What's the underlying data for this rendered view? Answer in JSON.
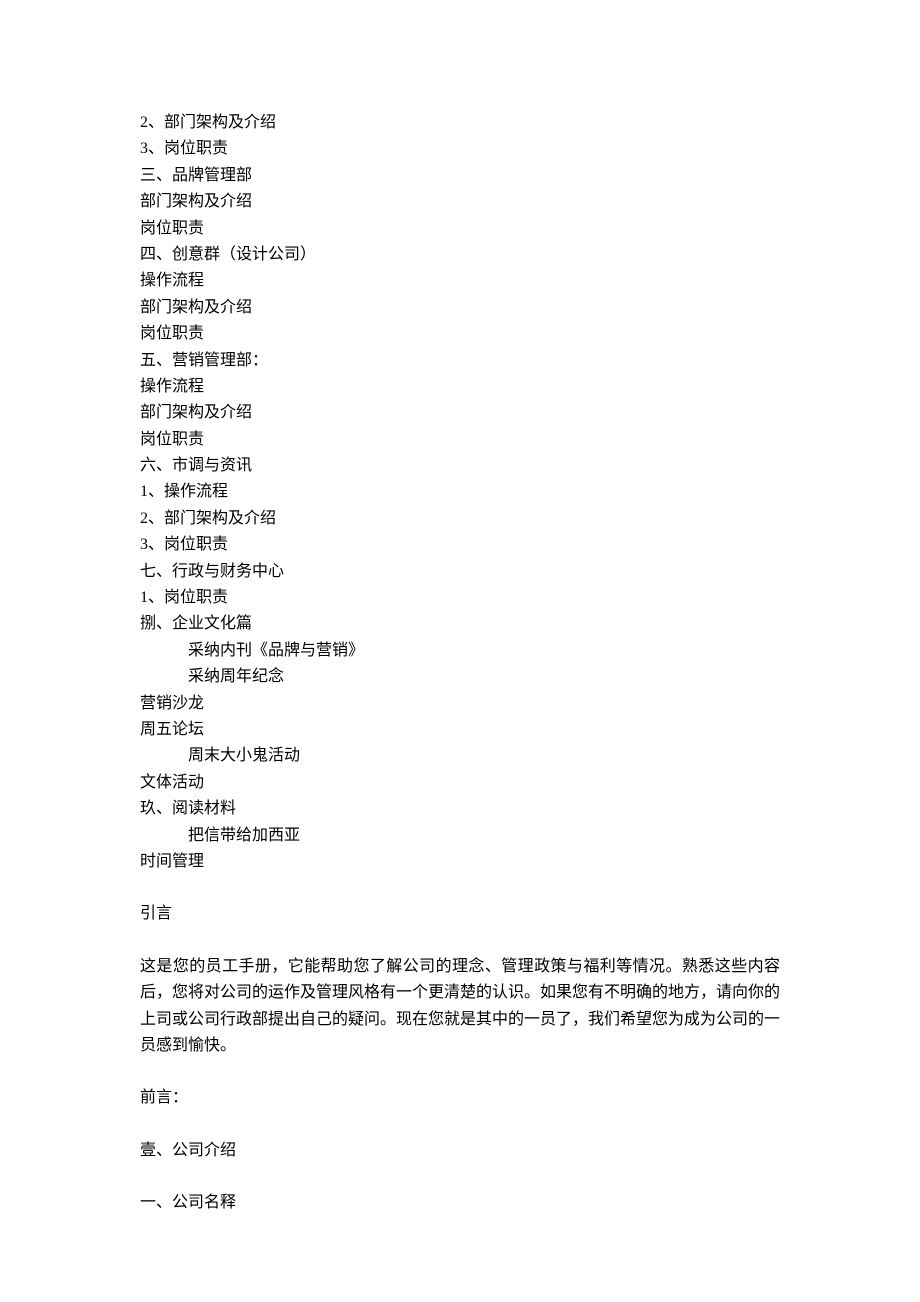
{
  "toc": [
    {
      "text": "2、部门架构及介绍",
      "indent": false
    },
    {
      "text": "3、岗位职责",
      "indent": false
    },
    {
      "text": "三、品牌管理部",
      "indent": false
    },
    {
      "text": "部门架构及介绍",
      "indent": false
    },
    {
      "text": "岗位职责",
      "indent": false
    },
    {
      "text": "四、创意群（设计公司）",
      "indent": false
    },
    {
      "text": "操作流程",
      "indent": false
    },
    {
      "text": "部门架构及介绍",
      "indent": false
    },
    {
      "text": "岗位职责",
      "indent": false
    },
    {
      "text": "五、营销管理部：",
      "indent": false
    },
    {
      "text": "操作流程",
      "indent": false
    },
    {
      "text": "部门架构及介绍",
      "indent": false
    },
    {
      "text": "岗位职责",
      "indent": false
    },
    {
      "text": "六、市调与资讯",
      "indent": false
    },
    {
      "text": "1、操作流程",
      "indent": false
    },
    {
      "text": "2、部门架构及介绍",
      "indent": false
    },
    {
      "text": "3、岗位职责",
      "indent": false
    },
    {
      "text": "七、行政与财务中心",
      "indent": false
    },
    {
      "text": "1、岗位职责",
      "indent": false
    },
    {
      "text": "捌、企业文化篇",
      "indent": false
    },
    {
      "text": "采纳内刊《品牌与营销》",
      "indent": true
    },
    {
      "text": "采纳周年纪念",
      "indent": true
    },
    {
      "text": "营销沙龙",
      "indent": false
    },
    {
      "text": "周五论坛",
      "indent": false
    },
    {
      "text": "周末大小鬼活动",
      "indent": true
    },
    {
      "text": "文体活动",
      "indent": false
    },
    {
      "text": "玖、阅读材料",
      "indent": false
    },
    {
      "text": "把信带给加西亚",
      "indent": true
    },
    {
      "text": "时间管理",
      "indent": false
    }
  ],
  "sections": {
    "intro_heading": "引言",
    "intro_body": "这是您的员工手册，它能帮助您了解公司的理念、管理政策与福利等情况。熟悉这些内容后，您将对公司的运作及管理风格有一个更清楚的认识。如果您有不明确的地方，请向你的上司或公司行政部提出自己的疑问。现在您就是其中的一员了，我们希望您为成为公司的一员感到愉快。",
    "preface_heading": "前言：",
    "chapter1_heading": "壹、公司介绍",
    "section1_heading": "一、公司名释"
  }
}
